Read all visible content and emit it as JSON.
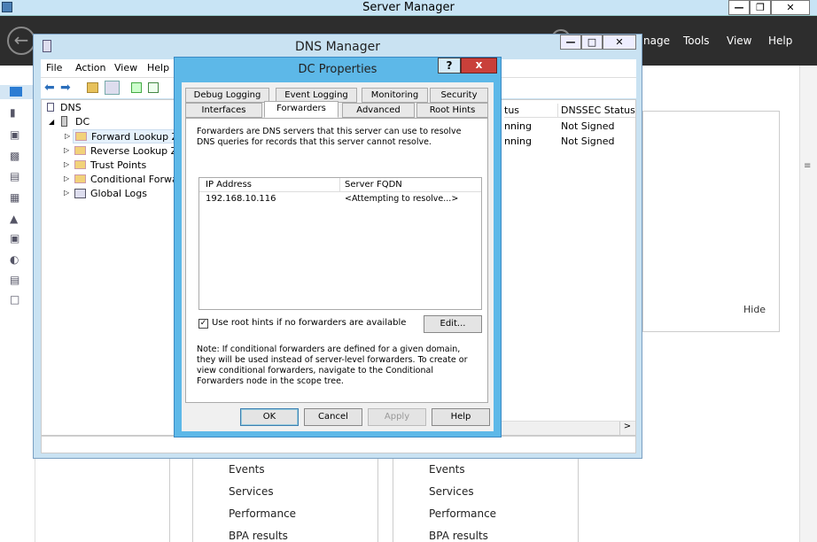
{
  "server_manager": {
    "title": "Server Manager",
    "menu": [
      "nage",
      "Tools",
      "View",
      "Help"
    ],
    "hide_label": "Hide",
    "tiles": {
      "col1": [
        "Events",
        "Services",
        "Performance",
        "BPA results"
      ],
      "col2": [
        "Events",
        "Services",
        "Performance",
        "BPA results"
      ]
    }
  },
  "dns_manager": {
    "title": "DNS Manager",
    "menu": [
      "File",
      "Action",
      "View",
      "Help"
    ],
    "tree": {
      "root": "DNS",
      "server": "DC",
      "items": [
        "Forward Lookup Zor",
        "Reverse Lookup Zor",
        "Trust Points",
        "Conditional Forward",
        "Global Logs"
      ]
    },
    "columns": {
      "status": "tus",
      "dnssec": "DNSSEC Status"
    },
    "rows": [
      {
        "status": "nning",
        "dnssec": "Not Signed"
      },
      {
        "status": "nning",
        "dnssec": "Not Signed"
      }
    ],
    "scroll_right": ">"
  },
  "dialog": {
    "title": "DC Properties",
    "help_btn": "?",
    "close_btn": "x",
    "tabs_row1": [
      "Debug Logging",
      "Event Logging",
      "Monitoring",
      "Security"
    ],
    "tabs_row2": [
      "Interfaces",
      "Forwarders",
      "Advanced",
      "Root Hints"
    ],
    "selected_tab": "Forwarders",
    "description": "Forwarders are DNS servers that this server can use to resolve DNS queries for records that this server cannot resolve.",
    "table": {
      "headers": [
        "IP Address",
        "Server FQDN"
      ],
      "rows": [
        {
          "ip": "192.168.10.116",
          "fqdn": "<Attempting to resolve...>"
        }
      ]
    },
    "checkbox_label": "Use root hints if no forwarders are available",
    "checkbox_checked": true,
    "edit_btn": "Edit...",
    "note": "Note: If conditional forwarders are defined for a given domain, they will be used instead of server-level forwarders.  To create or view conditional forwarders, navigate to the Conditional Forwarders node in the scope tree.",
    "buttons": {
      "ok": "OK",
      "cancel": "Cancel",
      "apply": "Apply",
      "help": "Help"
    }
  }
}
